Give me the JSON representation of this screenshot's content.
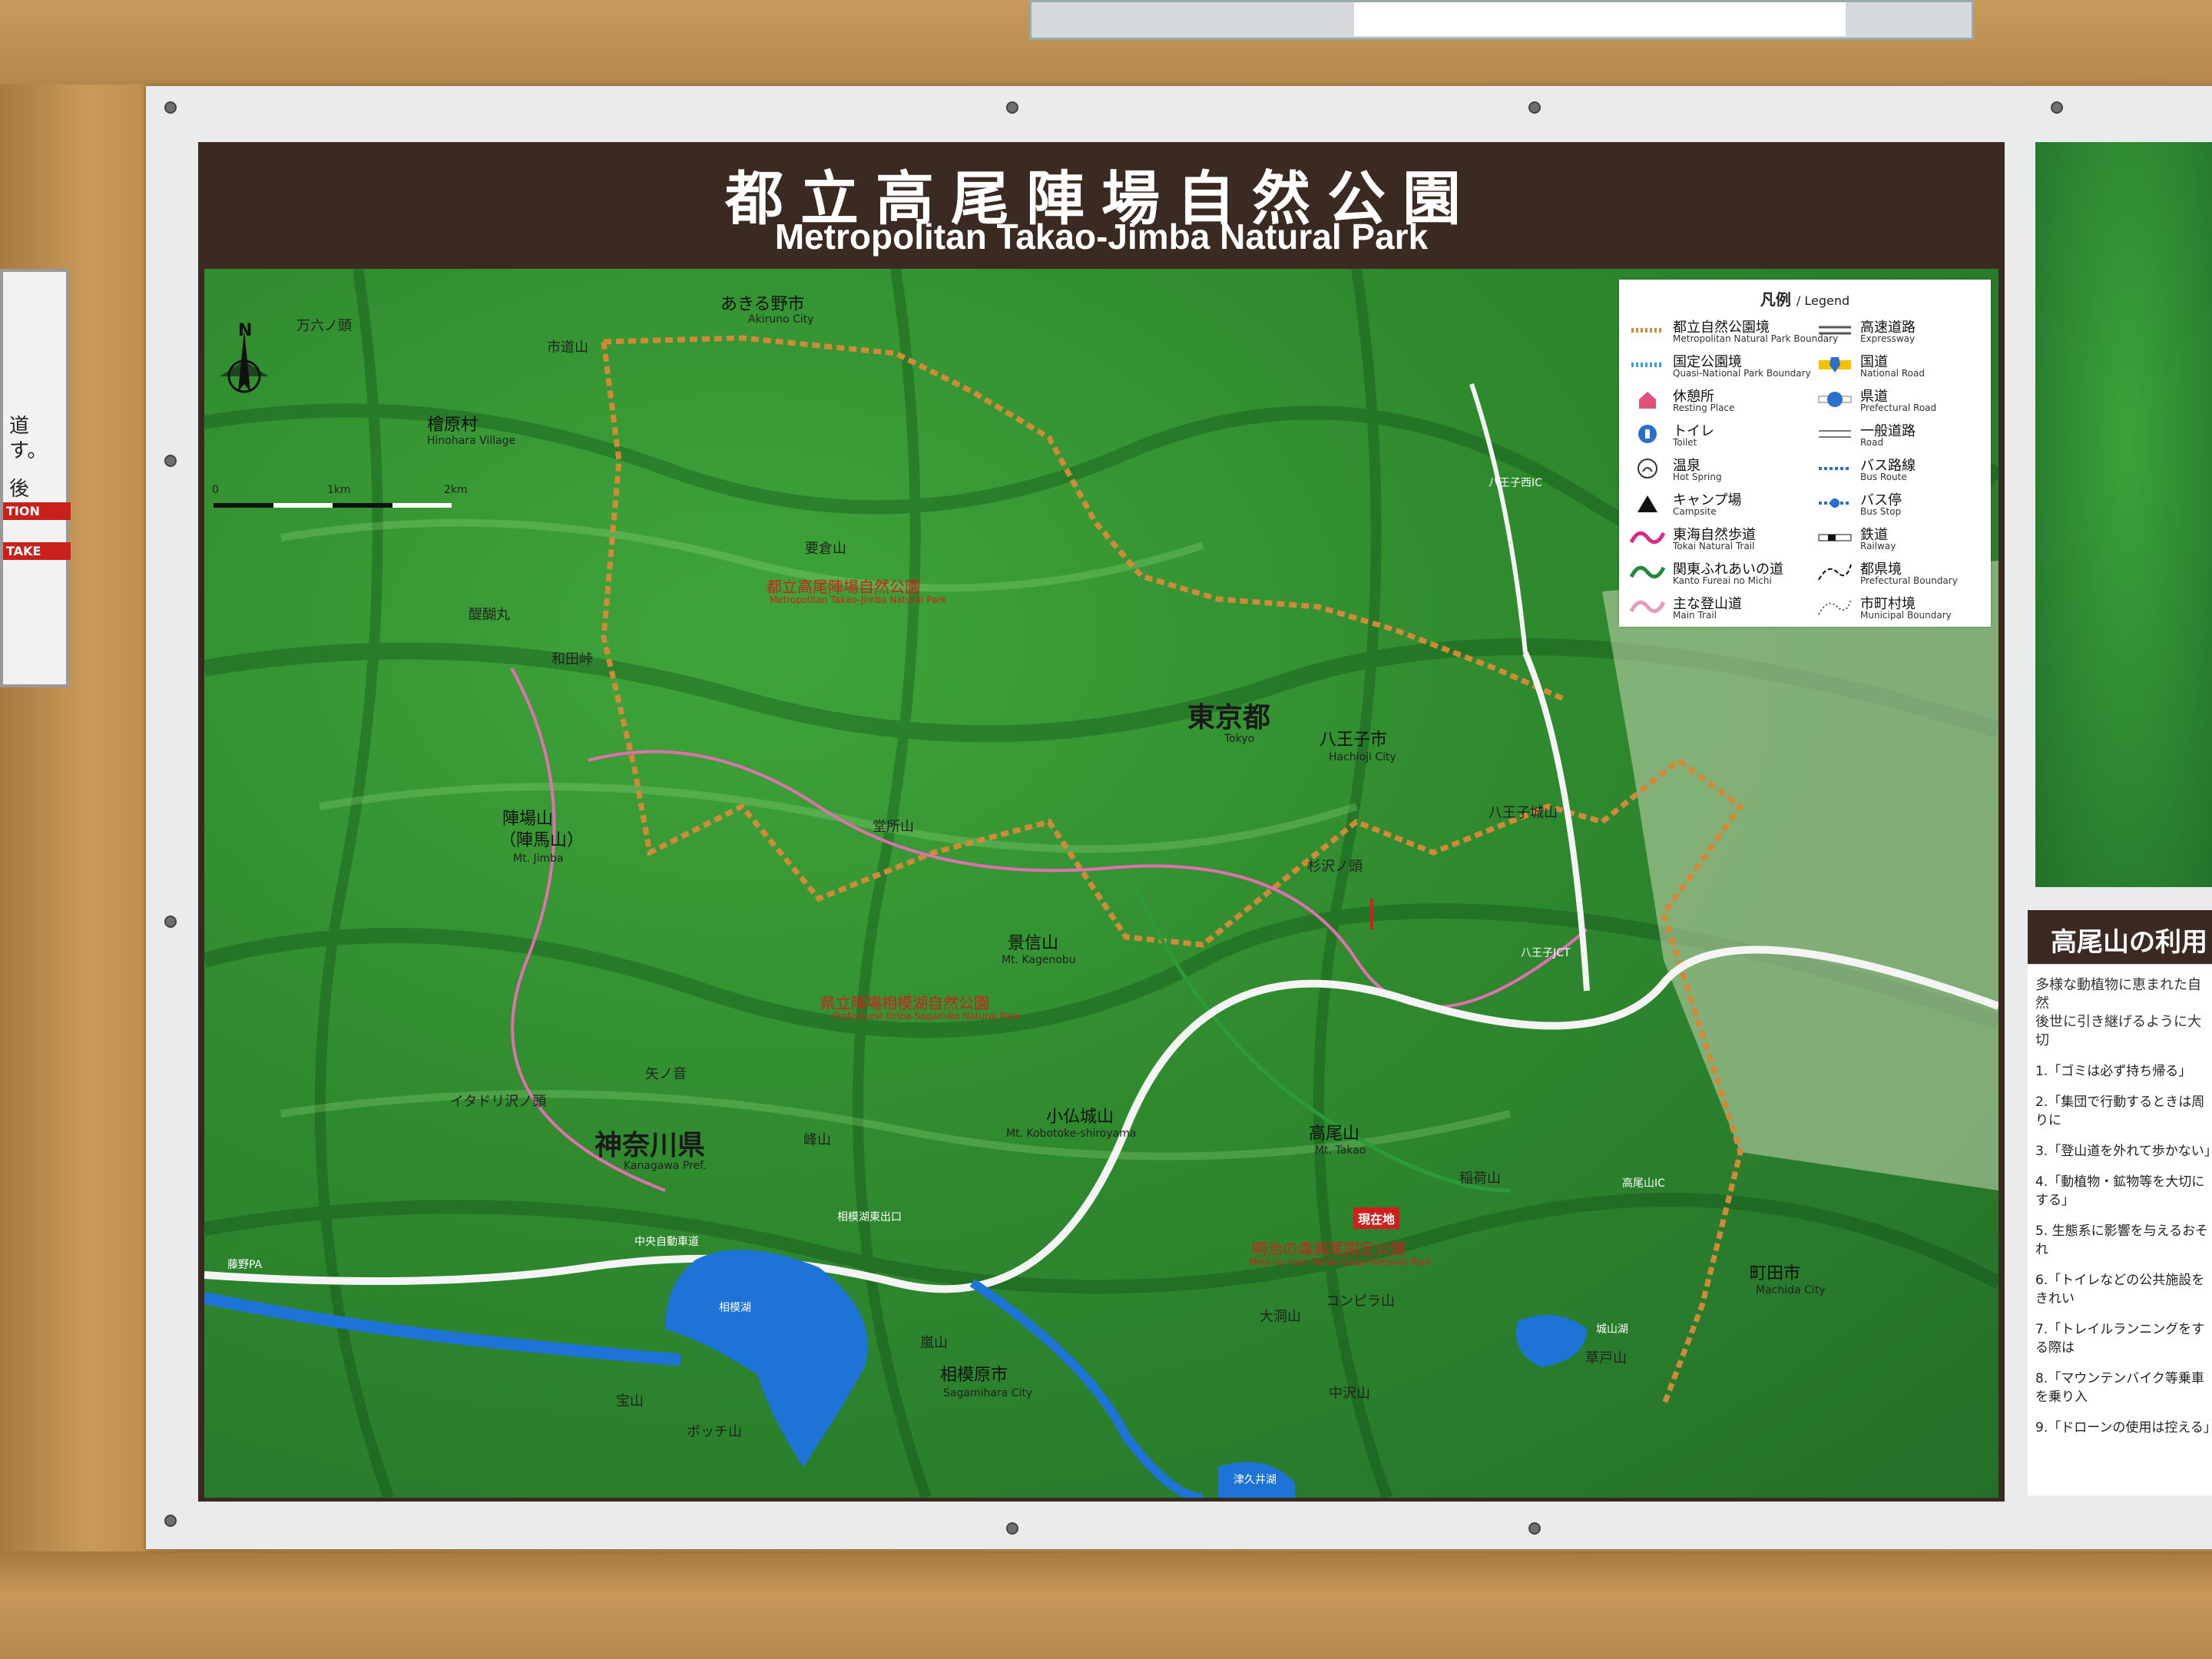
{
  "banner": {
    "title_jp": "都立高尾陣場自然公園",
    "title_en": "Metropolitan Takao-Jimba Natural Park"
  },
  "colors": {
    "banner_bg": "#3b2a22",
    "map_green": "#2f8a2e",
    "water": "#1e73d6",
    "boundary": "#d08a3a",
    "trail_red": "#d0201e"
  },
  "legend": {
    "title": "凡例",
    "title_en": "/ Legend",
    "left": [
      {
        "jp": "都立自然公園境",
        "en": "Metropolitan Natural Park Boundary",
        "icon": "orange-dotted-line-icon"
      },
      {
        "jp": "国定公園境",
        "en": "Quasi-National Park Boundary",
        "icon": "blue-dotted-line-icon"
      },
      {
        "jp": "休憩所",
        "en": "Resting Place",
        "icon": "house-icon"
      },
      {
        "jp": "トイレ",
        "en": "Toilet",
        "icon": "toilet-icon"
      },
      {
        "jp": "温泉",
        "en": "Hot Spring",
        "icon": "hot-spring-icon"
      },
      {
        "jp": "キャンプ場",
        "en": "Campsite",
        "icon": "tent-icon"
      },
      {
        "jp": "東海自然歩道",
        "en": "Tokai Natural Trail",
        "icon": "magenta-trail-icon"
      },
      {
        "jp": "関東ふれあいの道",
        "en": "Kanto Fureai no Michi",
        "icon": "green-trail-icon"
      },
      {
        "jp": "主な登山道",
        "en": "Main Trail",
        "icon": "pink-trail-icon"
      }
    ],
    "right": [
      {
        "jp": "高速道路",
        "en": "Expressway",
        "icon": "expressway-icon"
      },
      {
        "jp": "国道",
        "en": "National Road",
        "icon": "national-road-icon"
      },
      {
        "jp": "県道",
        "en": "Prefectural Road",
        "icon": "prefectural-road-icon"
      },
      {
        "jp": "一般道路",
        "en": "Road",
        "icon": "road-icon"
      },
      {
        "jp": "バス路線",
        "en": "Bus Route",
        "icon": "bus-route-icon"
      },
      {
        "jp": "バス停",
        "en": "Bus Stop",
        "icon": "bus-stop-icon"
      },
      {
        "jp": "鉄道",
        "en": "Railway",
        "icon": "railway-icon"
      },
      {
        "jp": "都県境",
        "en": "Prefectural Boundary",
        "icon": "prefectural-boundary-icon"
      },
      {
        "jp": "市町村境",
        "en": "Municipal Boundary",
        "icon": "municipal-boundary-icon"
      }
    ]
  },
  "scale": {
    "zero": "0",
    "one": "1km",
    "two": "2km",
    "north": "N"
  },
  "places": {
    "akiruno": "あきる野市",
    "akiruno_en": "Akiruno City",
    "hinohara": "檜原村",
    "hinohara_en": "Hinohara Village",
    "tokyo": "東京都",
    "tokyo_en": "Tokyo",
    "hachioji": "八王子市",
    "hachioji_en": "Hachioji City",
    "kanagawa": "神奈川県",
    "kanagawa_en": "Kanagawa Pref.",
    "sagamihara": "相模原市",
    "sagamihara_en": "Sagamihara City",
    "machida": "町田市",
    "machida_en": "Machida City",
    "park_name": "都立高尾陣場自然公園",
    "park_name_en": "Metropolitan Takao-Jimba Natural Park",
    "pref_park": "県立陣場相模湖自然公園",
    "pref_park_en": "Prefectural Jimba-Sagamiko Natural Park",
    "meiji_park": "明治の森高尾国定公園",
    "meiji_park_en": "Meiji no mori Takao Quasi-National Park",
    "sagamiko": "相模湖",
    "tsukui": "津久井湖",
    "shiroyama_lake": "城山湖"
  },
  "mountains": {
    "jimba": "陣場山",
    "jimba_alt": "（陣馬山）",
    "jimba_en": "Mt. Jimba",
    "kagenobu": "景信山",
    "kagenobu_en": "Mt. Kagenobu",
    "kobotoke": "小仏城山",
    "kobotoke_en": "Mt. Kobotoke-shiroyama",
    "takao": "高尾山",
    "takao_en": "Mt. Takao",
    "yosokura": "要倉山",
    "dodokoro": "堂所山",
    "mandanoatama": "万六ノ頭",
    "ichimichi": "市道山",
    "daigo": "醍醐丸",
    "wada": "和田峠",
    "itadori": "イタドリ沢ノ頭",
    "yano": "矢ノ音",
    "sugisawa": "杉沢ノ頭",
    "hachiojijo": "八王子城山",
    "inari": "稲荷山",
    "kunugi": "嵐山",
    "takara": "宝山",
    "bonbori": "ボッチ山",
    "kompira": "コンピラ山",
    "ooyama": "大洞山",
    "nakazawa": "中沢山",
    "kusado": "草戸山",
    "tsukazaki": "峰山"
  },
  "roads": {
    "chuo_exp": "中央自動車道",
    "hachioji_ic": "八王子西IC",
    "hachioji_jct": "八王子JCT",
    "takaosan_ic": "高尾山IC",
    "sagamiko_ic": "相模湖東出口",
    "fujino_pa": "藤野PA"
  },
  "current_location": "現在地",
  "right_panel": {
    "heading": "高尾山の利用ル",
    "lead": "多様な動植物に恵まれた自然",
    "lead2": "後世に引き継げるように大切",
    "items": [
      "1.「ゴミは必ず持ち帰る」",
      "2.「集団で行動するときは周りに",
      "3.「登山道を外れて歩かない」",
      "4.「動植物・鉱物等を大切にする」",
      "5. 生態系に影響を与えるおそれ",
      "6.「トイレなどの公共施設をきれい",
      "7.「トレイルランニングをする際は",
      "8.「マウンテンバイク等乗車を乗り入",
      "9.「ドローンの使用は控える」"
    ]
  },
  "left_sign": {
    "line1": "道",
    "line2": "す。",
    "line3": "後",
    "red1": "TION",
    "red2": "TAKE"
  }
}
